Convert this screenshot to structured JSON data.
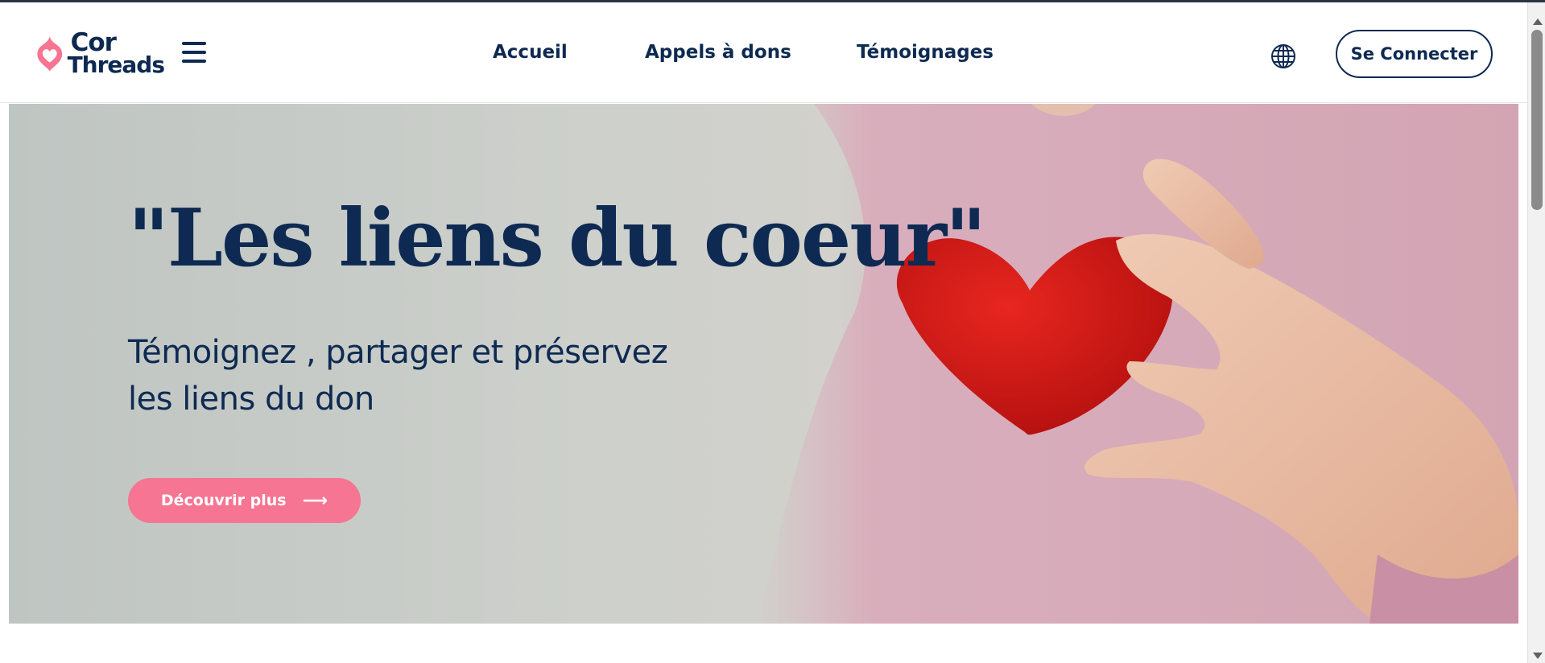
{
  "brand": {
    "line1": "Cor",
    "line2": "Threads",
    "logo_icon": "heart-drop-icon",
    "accent_color": "#f57592",
    "primary_color": "#0e2a52"
  },
  "header": {
    "menu_icon": "hamburger-menu-icon",
    "nav": [
      {
        "label": "Accueil"
      },
      {
        "label": "Appels à dons"
      },
      {
        "label": "Témoignages"
      }
    ],
    "language_icon": "globe-icon",
    "login_label": "Se Connecter"
  },
  "hero": {
    "title": "\"Les liens du coeur\"",
    "subtitle_line1": "Témoignez , partager et préservez",
    "subtitle_line2": "les liens du don",
    "cta_label": "Découvrir plus",
    "cta_icon": "arrow-right-icon",
    "image_subject": "hand-holding-red-heart"
  }
}
